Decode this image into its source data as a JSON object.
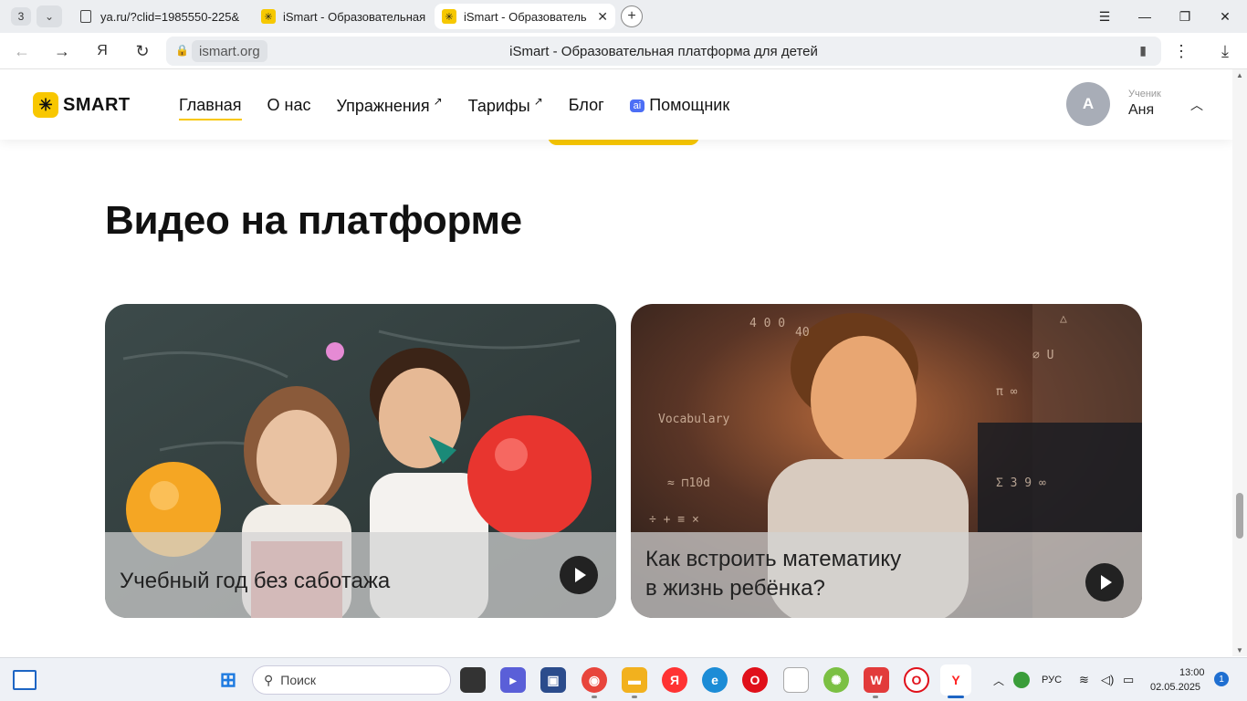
{
  "browser": {
    "tab_count": "3",
    "tabs": [
      {
        "title": "ya.ru/?clid=1985550-225&",
        "icon": "page-icon"
      },
      {
        "title": "iSmart - Образовательная",
        "icon": "ismart-favicon"
      },
      {
        "title": "iSmart - Образователь",
        "icon": "ismart-favicon"
      }
    ],
    "address": {
      "domain": "ismart.org",
      "page_title": "iSmart - Образовательная платформа для детей"
    }
  },
  "site": {
    "logo_text": "SMART",
    "nav": [
      {
        "label": "Главная",
        "active": true
      },
      {
        "label": "О нас"
      },
      {
        "label": "Упражнения",
        "external": "↗"
      },
      {
        "label": "Тарифы",
        "external": "↗"
      },
      {
        "label": "Блог"
      },
      {
        "label": "Помощник",
        "badge": "ai"
      }
    ],
    "user": {
      "initial": "А",
      "role": "Ученик",
      "name": "Аня"
    }
  },
  "main": {
    "section_title": "Видео на платформе",
    "videos": [
      {
        "caption": "Учебный год без саботажа"
      },
      {
        "caption_line1": "Как встроить математику",
        "caption_line2": "в жизнь ребёнка?"
      }
    ]
  },
  "taskbar": {
    "search_placeholder": "Поиск",
    "lang": "РУС",
    "time": "13:00",
    "date": "02.05.2025",
    "notifications": "1"
  },
  "colors": {
    "brand_yellow": "#f8c700",
    "ai_badge": "#4c6ef5"
  }
}
